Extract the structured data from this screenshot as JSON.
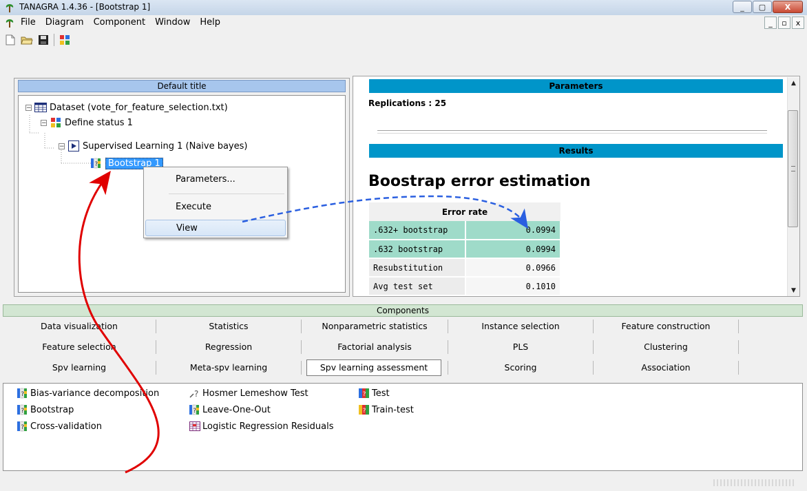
{
  "window": {
    "title": "TANAGRA 1.4.36 - [Bootstrap 1]",
    "minimize": "_",
    "maximize": "▢",
    "close": "X"
  },
  "menu": {
    "items": [
      "File",
      "Diagram",
      "Component",
      "Window",
      "Help"
    ],
    "mdi": [
      "_",
      "▫",
      "x"
    ]
  },
  "tree": {
    "header": "Default title",
    "nodes": [
      {
        "label": "Dataset (vote_for_feature_selection.txt)",
        "expander": "−"
      },
      {
        "label": "Define status 1",
        "expander": "−"
      },
      {
        "label": "Supervised Learning 1 (Naive bayes)",
        "expander": "−"
      },
      {
        "label": "Bootstrap 1"
      }
    ]
  },
  "context_menu": {
    "items": [
      "Parameters...",
      "Execute",
      "View"
    ]
  },
  "results": {
    "parameters_header": "Parameters",
    "replications": "Replications : 25",
    "results_header": "Results",
    "heading": "Boostrap error estimation",
    "table_header": "Error rate",
    "rows": [
      {
        "label": ".632+ bootstrap",
        "value": "0.0994"
      },
      {
        "label": ".632 bootstrap",
        "value": "0.0994"
      },
      {
        "label": "Resubstitution",
        "value": "0.0966"
      },
      {
        "label": "Avg test set",
        "value": "0.1010"
      }
    ]
  },
  "components": {
    "header": "Components",
    "tabs_row1": [
      "Data visualization",
      "Statistics",
      "Nonparametric statistics",
      "Instance selection",
      "Feature construction"
    ],
    "tabs_row2": [
      "Feature selection",
      "Regression",
      "Factorial analysis",
      "PLS",
      "Clustering"
    ],
    "tabs_row3": [
      "Spv learning",
      "Meta-spv learning",
      "Spv learning assessment",
      "Scoring",
      "Association"
    ],
    "active_tab": "Spv learning assessment",
    "items_col1": [
      "Bias-variance decomposition",
      "Bootstrap",
      "Cross-validation"
    ],
    "items_col2": [
      "Hosmer Lemeshow Test",
      "Leave-One-Out",
      "Logistic Regression Residuals"
    ],
    "items_col3": [
      "Test",
      "Train-test"
    ]
  },
  "colors": {
    "results_bar": "#0095c9",
    "row_highlight": "#9fdbc9",
    "selection": "#3399ff",
    "annotation_red": "#e00000",
    "annotation_blue": "#2a5fe0"
  }
}
